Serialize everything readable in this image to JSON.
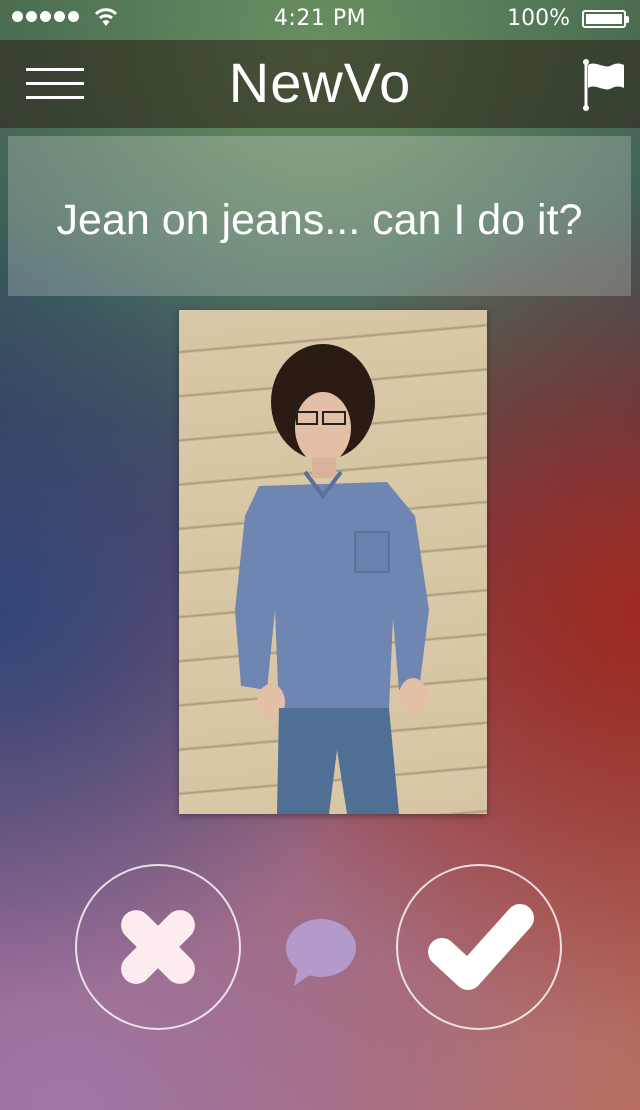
{
  "status_bar": {
    "time": "4:21 PM",
    "battery_percent": "100%",
    "signal_icon": "signal-dots-icon",
    "wifi_icon": "wifi-icon",
    "battery_icon": "battery-icon",
    "battery_level": 1.0
  },
  "nav": {
    "title": "NewVo",
    "menu_icon": "hamburger-menu-icon",
    "flag_icon": "flag-icon"
  },
  "post": {
    "question": "Jean on jeans... can I do it?",
    "photo_icon": "person-photo"
  },
  "actions": {
    "reject_icon": "x-icon",
    "comment_icon": "speech-bubble-icon",
    "approve_icon": "checkmark-icon"
  },
  "colors": {
    "nav_background": "#2a2115",
    "comment_bubble": "#b39acb",
    "reject_mark": "#fdecef",
    "approve_mark": "#ffffff"
  }
}
